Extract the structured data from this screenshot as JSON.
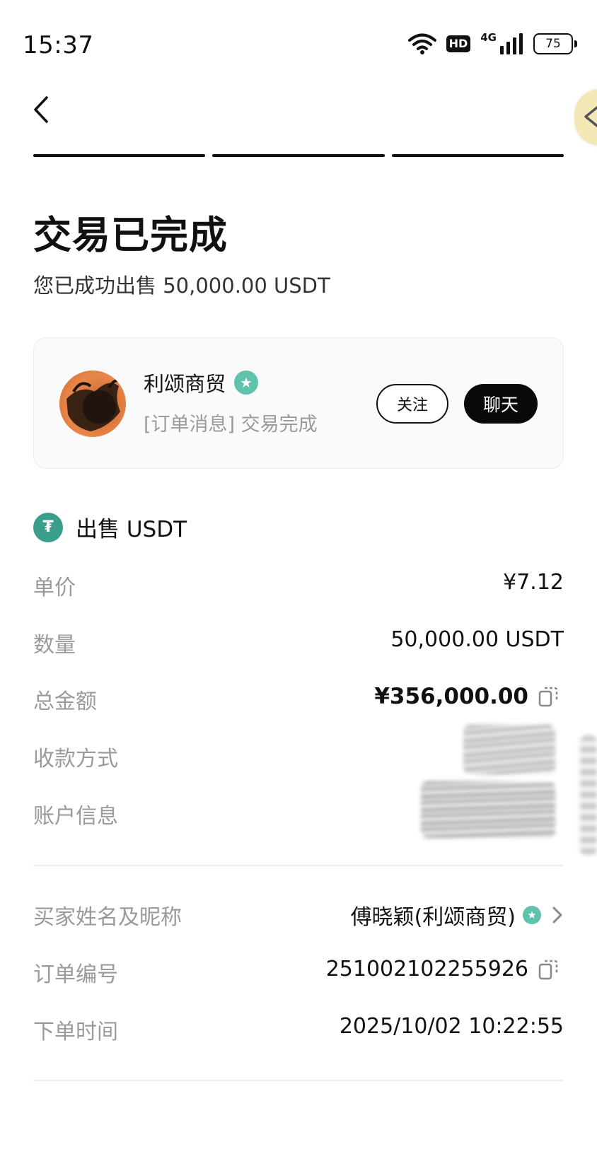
{
  "status_bar": {
    "time": "15:37",
    "hd": "HD",
    "network": "4G",
    "battery": "75",
    "icons": [
      "wifi-icon",
      "signal-icon",
      "battery-icon"
    ]
  },
  "nav": {
    "back_icon": "chevron-left-icon",
    "progress_steps": 3
  },
  "header": {
    "title": "交易已完成",
    "subtitle": "您已成功出售 50,000.00 USDT"
  },
  "merchant": {
    "name": "利颂商贸",
    "verified_icon": "verified-star-icon",
    "message": "[订单消息] 交易完成",
    "follow_label": "关注",
    "chat_label": "聊天"
  },
  "order": {
    "section_title": "出售 USDT",
    "coin_icon": "usdt-icon",
    "unit_price_label": "单价",
    "unit_price_value": "¥7.12",
    "quantity_label": "数量",
    "quantity_value": "50,000.00 USDT",
    "total_label": "总金额",
    "total_value": "¥356,000.00",
    "payment_method_label": "收款方式",
    "account_info_label": "账户信息",
    "buyer_label": "买家姓名及昵称",
    "buyer_value": "傅晓颖(利颂商贸)",
    "order_no_label": "订单编号",
    "order_no_value": "251002102255926",
    "order_time_label": "下单时间",
    "order_time_value": "2025/10/02 10:22:55"
  },
  "colors": {
    "accent_dark": "#0a0a0a",
    "verified_green": "#5ec2ad",
    "usdt_green": "#3a9e8a",
    "muted_text": "#9a9a9a"
  }
}
